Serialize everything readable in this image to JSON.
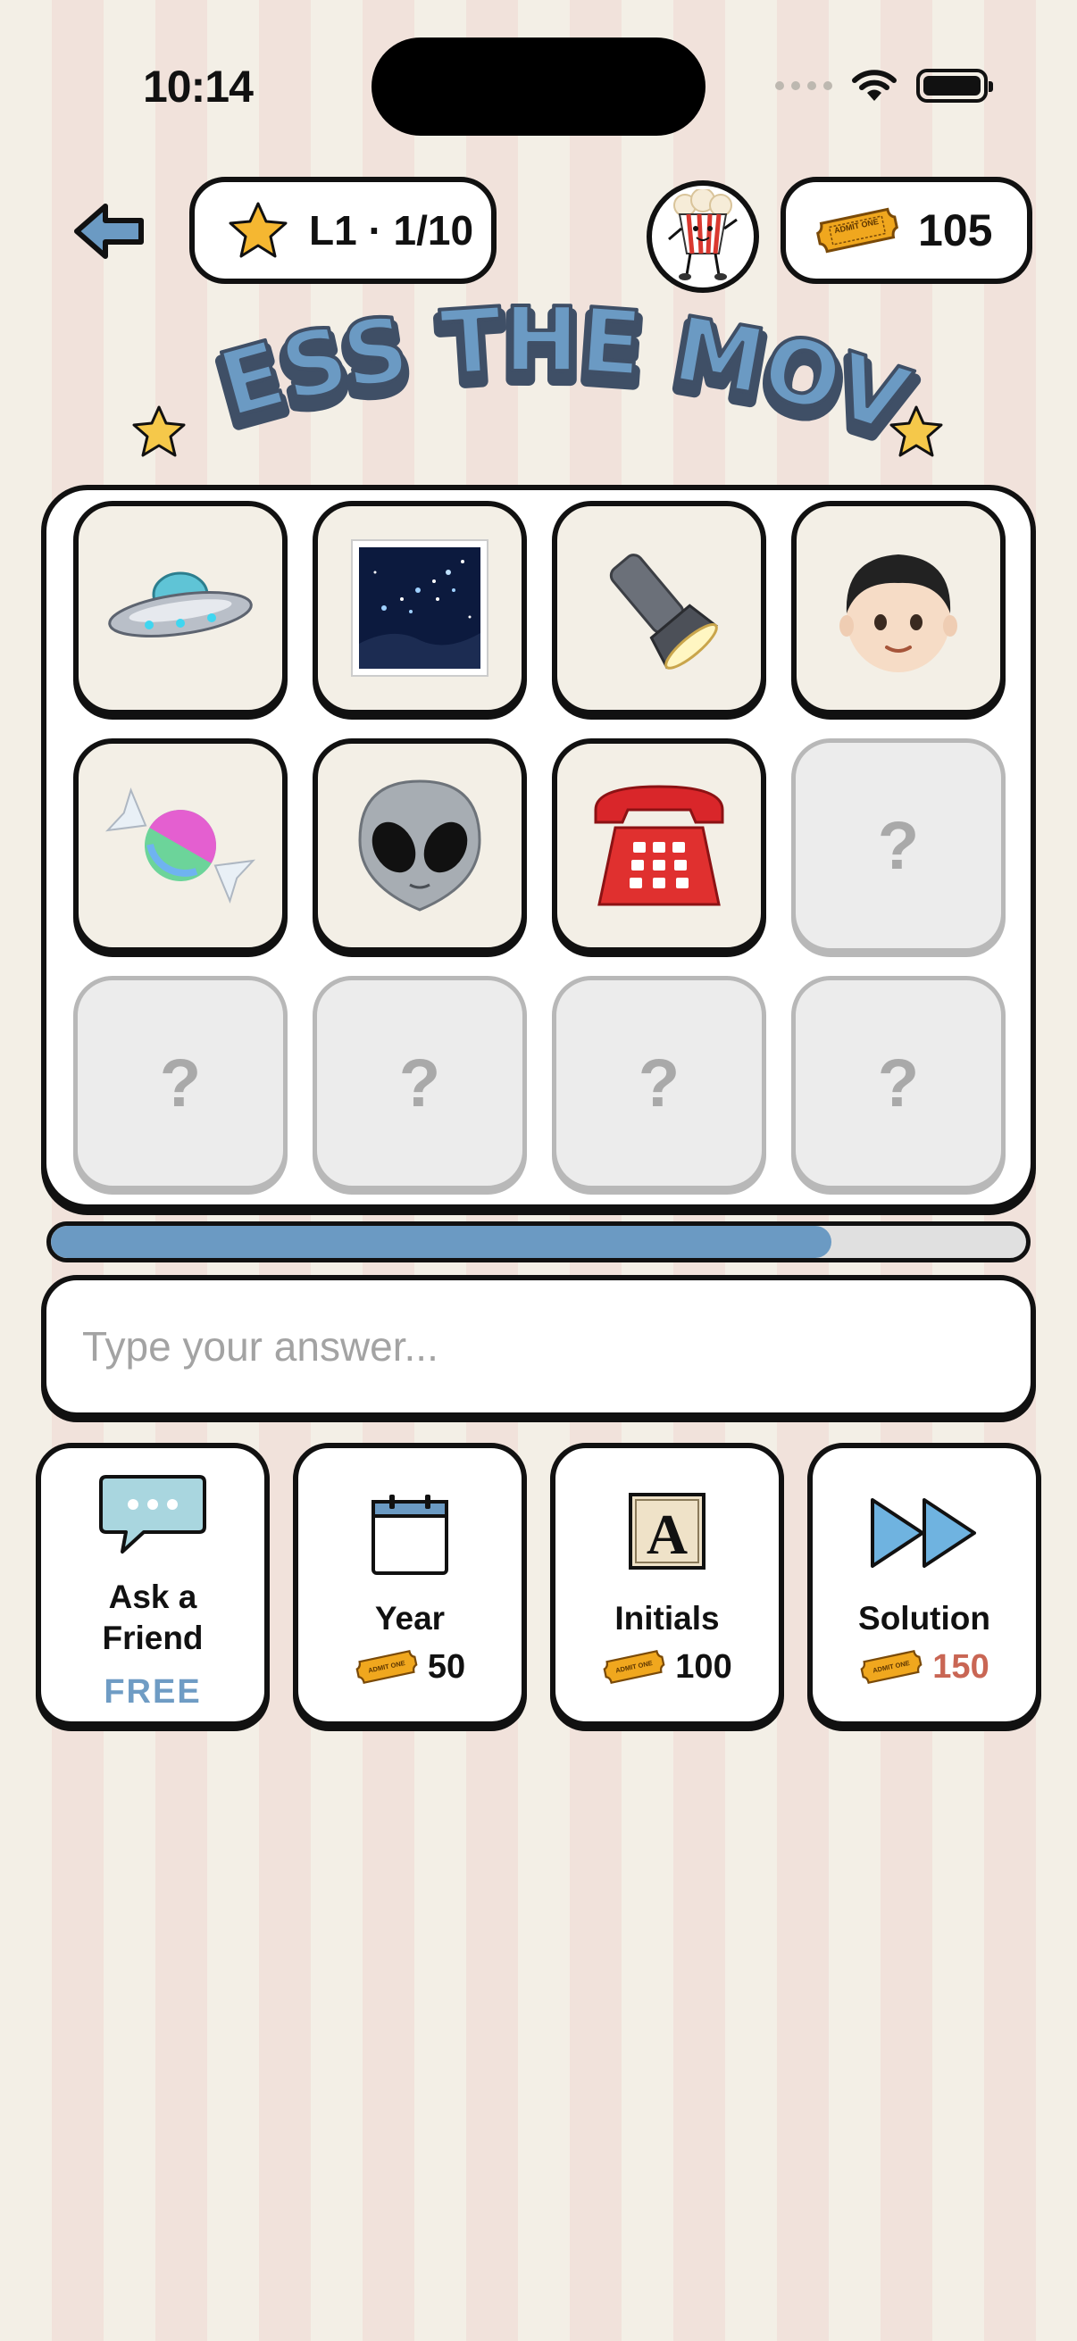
{
  "status": {
    "time": "10:14"
  },
  "header": {
    "level_label": "L1 · 1/10",
    "coins": "105",
    "back_icon": "back-arrow-icon",
    "avatar_icon": "popcorn-mascot-icon",
    "ticket_icon": "admit-one-ticket-icon",
    "ticket_text": "ADMIT ONE"
  },
  "title": "GUESS THE MOVIE",
  "grid": {
    "tiles": [
      {
        "state": "revealed",
        "emoji": "🛸",
        "name": "ufo"
      },
      {
        "state": "revealed",
        "emoji": "🌌",
        "name": "night-sky"
      },
      {
        "state": "revealed",
        "emoji": "🔦",
        "name": "flashlight"
      },
      {
        "state": "revealed",
        "emoji": "👦",
        "name": "boy"
      },
      {
        "state": "revealed",
        "emoji": "🍬",
        "name": "candy"
      },
      {
        "state": "revealed",
        "emoji": "👽",
        "name": "alien"
      },
      {
        "state": "revealed",
        "emoji": "☎️",
        "name": "telephone"
      },
      {
        "state": "hidden",
        "emoji": "?"
      },
      {
        "state": "hidden",
        "emoji": "?"
      },
      {
        "state": "hidden",
        "emoji": "?"
      },
      {
        "state": "hidden",
        "emoji": "?"
      },
      {
        "state": "hidden",
        "emoji": "?"
      }
    ]
  },
  "progress": {
    "fraction": 0.8
  },
  "answer": {
    "placeholder": "Type your answer...",
    "value": ""
  },
  "hints": [
    {
      "title": "Ask a Friend",
      "cost": "FREE",
      "icon": "speech-bubble-icon"
    },
    {
      "title": "Year",
      "cost": "50",
      "icon": "calendar-icon"
    },
    {
      "title": "Initials",
      "cost": "100",
      "icon": "letter-a-tile-icon",
      "letter": "A"
    },
    {
      "title": "Solution",
      "cost": "150",
      "icon": "fast-forward-icon"
    }
  ],
  "colors": {
    "accent_blue": "#6f9cc4",
    "cost_red": "#c96654",
    "star_yellow": "#f5b731",
    "ticket_orange": "#f0a71e"
  }
}
